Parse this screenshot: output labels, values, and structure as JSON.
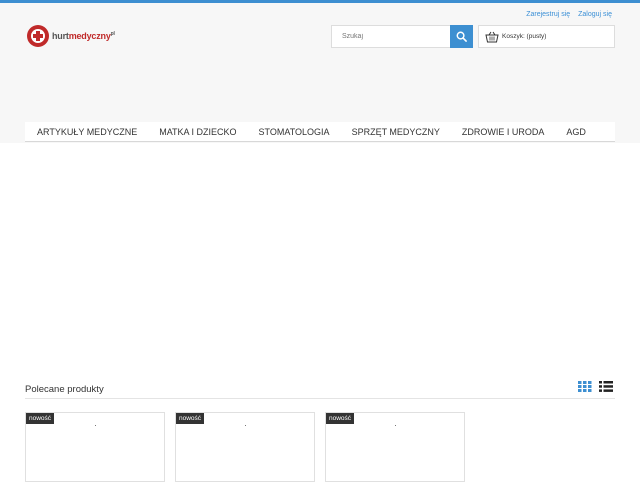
{
  "header": {
    "user_links": [
      "Zarejestruj się",
      "Zaloguj się"
    ],
    "logo": {
      "part1": "hurt",
      "part2": "medyczny",
      "suffix": "pl"
    },
    "search": {
      "placeholder": "Szukaj",
      "icon": "search-icon"
    },
    "cart": {
      "label": "Koszyk: (pusty)",
      "icon": "basket-icon"
    }
  },
  "nav": {
    "items": [
      "ARTYKUŁY MEDYCZNE",
      "MATKA I DZIECKO",
      "STOMATOLOGIA",
      "SPRZĘT MEDYCZNY",
      "ZDROWIE I URODA",
      "AGD"
    ]
  },
  "featured": {
    "title": "Polecane produkty",
    "view_icons": [
      "grid-view-icon",
      "list-view-icon"
    ],
    "products": [
      {
        "badge": "nowość"
      },
      {
        "badge": "nowość"
      },
      {
        "badge": "nowość"
      }
    ]
  },
  "colors": {
    "accent": "#3d8fd1",
    "brand_red": "#c02a2a",
    "badge_bg": "#333333"
  }
}
